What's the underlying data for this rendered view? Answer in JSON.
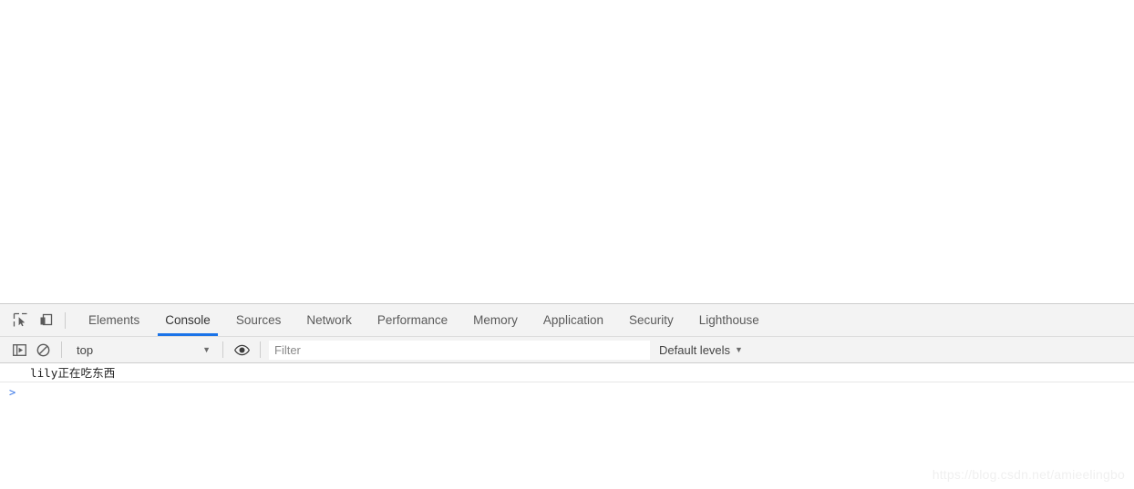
{
  "browser": {
    "page_area_background": "#ffffff"
  },
  "devtools": {
    "toolbar": {
      "inspect_icon": "inspect-element-icon",
      "device_toggle_icon": "device-toolbar-icon",
      "tabs": [
        {
          "label": "Elements",
          "active": false
        },
        {
          "label": "Console",
          "active": true
        },
        {
          "label": "Sources",
          "active": false
        },
        {
          "label": "Network",
          "active": false
        },
        {
          "label": "Performance",
          "active": false
        },
        {
          "label": "Memory",
          "active": false
        },
        {
          "label": "Application",
          "active": false
        },
        {
          "label": "Security",
          "active": false
        },
        {
          "label": "Lighthouse",
          "active": false
        }
      ],
      "active_tab_accent": "#1a73e8"
    },
    "filterbar": {
      "sidebar_toggle_icon": "console-sidebar-icon",
      "clear_console_icon": "clear-console-icon",
      "context": {
        "value": "top",
        "caret": "▼"
      },
      "eye_icon": "eye-icon",
      "filter": {
        "value": "",
        "placeholder": "Filter"
      },
      "levels": {
        "label": "Default levels",
        "caret": "▼"
      }
    },
    "console": {
      "messages": [
        {
          "text": "lily正在吃东西",
          "type": "log"
        }
      ],
      "prompt": ">"
    }
  },
  "watermark": {
    "text": "https://blog.csdn.net/amieelingbo"
  }
}
